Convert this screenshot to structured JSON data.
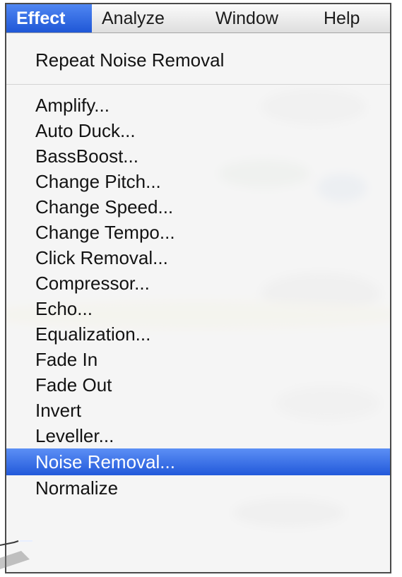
{
  "menubar": {
    "items": [
      {
        "label": "Effect",
        "active": true
      },
      {
        "label": "Analyze",
        "active": false
      },
      {
        "label": "Window",
        "active": false
      },
      {
        "label": "Help",
        "active": false
      }
    ]
  },
  "effect_menu": {
    "repeat_item": "Repeat Noise Removal",
    "items": [
      "Amplify...",
      "Auto Duck...",
      "BassBoost...",
      "Change Pitch...",
      "Change Speed...",
      "Change Tempo...",
      "Click Removal...",
      "Compressor...",
      "Echo...",
      "Equalization...",
      "Fade In",
      "Fade Out",
      "Invert",
      "Leveller...",
      "Noise Removal...",
      "Normalize"
    ],
    "highlighted_item": "Noise Removal..."
  },
  "colors": {
    "accent": "#2f69e2",
    "highlight_text": "#ffffff",
    "menu_text": "#131313"
  }
}
